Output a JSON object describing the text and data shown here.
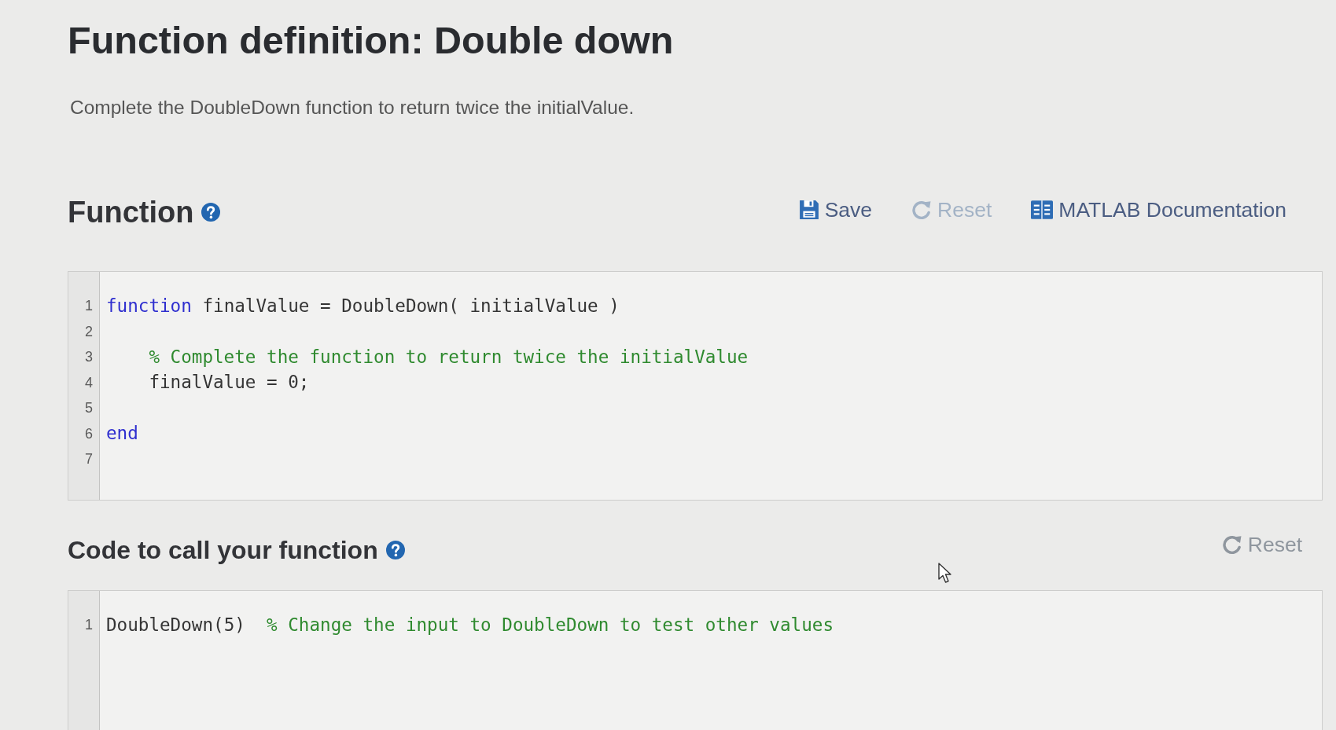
{
  "page": {
    "title": "Function definition: Double down",
    "description": "Complete the DoubleDown function to return twice the initialValue."
  },
  "function_section": {
    "heading": "Function",
    "toolbar": [
      {
        "kind": "save",
        "label": "Save",
        "disabled": false
      },
      {
        "kind": "reset",
        "label": "Reset",
        "disabled": true
      },
      {
        "kind": "docs",
        "label": "MATLAB Documentation",
        "disabled": false
      }
    ],
    "editor": {
      "lines": [
        {
          "number": "1",
          "tokens": [
            {
              "kind": "keyword",
              "text": "function"
            },
            {
              "kind": "code",
              "text": " finalValue = DoubleDown( initialValue )"
            }
          ],
          "children": [
            {
              "number": "2"
            },
            {
              "number": "3",
              "tokens": [
                {
                  "kind": "comment",
                  "text": "% Complete the function to return twice the initialValue"
                }
              ]
            },
            {
              "number": "4",
              "tokens": [
                {
                  "kind": "code",
                  "text": "finalValue = 0;"
                }
              ]
            },
            {
              "number": "5"
            }
          ]
        },
        {
          "number": "6",
          "tokens": [
            {
              "kind": "keyword",
              "text": "end"
            }
          ]
        },
        {
          "number": "7"
        }
      ]
    }
  },
  "call_section": {
    "heading": "Code to call your function",
    "toolbar": [
      {
        "kind": "reset",
        "label": "Reset",
        "disabled": true
      }
    ],
    "editor": {
      "lines": [
        {
          "number": "1",
          "tokens": [
            {
              "kind": "code",
              "text": "DoubleDown(5)"
            },
            {
              "kind": "comment",
              "text": "  % Change the input to DoubleDown to test other values"
            }
          ]
        }
      ]
    }
  }
}
